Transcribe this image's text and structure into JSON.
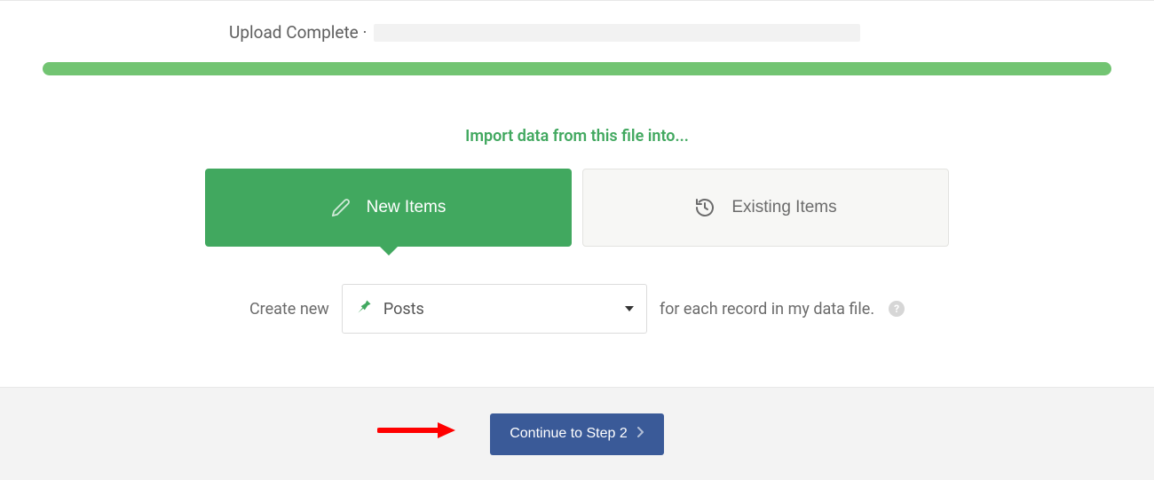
{
  "upload": {
    "status_text": "Upload Complete · "
  },
  "import": {
    "heading": "Import data from this file into...",
    "options": {
      "new_label": "New Items",
      "existing_label": "Existing Items"
    }
  },
  "config": {
    "prefix": "Create new",
    "selected_type": "Posts",
    "suffix": "for each record in my data file.",
    "help_glyph": "?"
  },
  "footer": {
    "continue_label": "Continue to Step 2"
  }
}
